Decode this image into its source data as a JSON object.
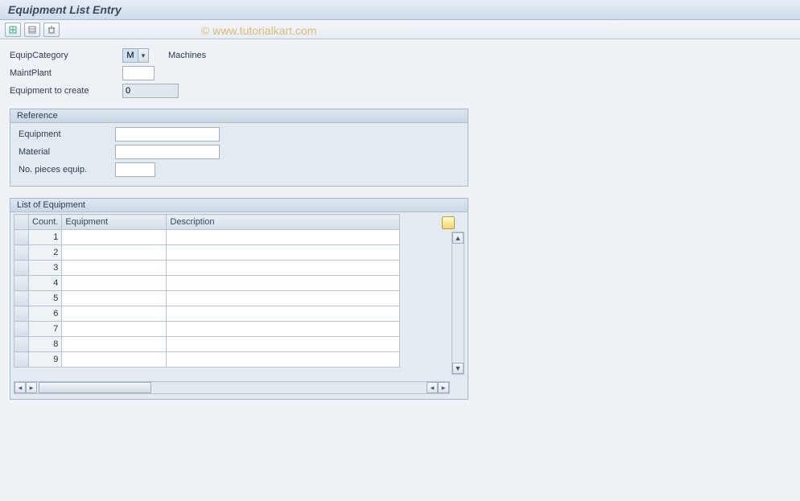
{
  "header": {
    "title": "Equipment List Entry"
  },
  "watermark": "© www.tutorialkart.com",
  "toolbar": {
    "btn_insert": "insert-row",
    "btn_select": "select-rows",
    "btn_delete": "delete-row"
  },
  "form": {
    "equip_category_label": "EquipCategory",
    "equip_category_value": "M",
    "equip_category_text": "Machines",
    "maint_plant_label": "MaintPlant",
    "maint_plant_value": "",
    "equip_to_create_label": "Equipment to create",
    "equip_to_create_value": "0"
  },
  "reference": {
    "title": "Reference",
    "equipment_label": "Equipment",
    "equipment_value": "",
    "material_label": "Material",
    "material_value": "",
    "pieces_label": "No. pieces equip.",
    "pieces_value": ""
  },
  "table": {
    "title": "List of Equipment",
    "columns": {
      "count": "Count.",
      "equipment": "Equipment",
      "description": "Description"
    },
    "rows": [
      {
        "count": "1",
        "equipment": "",
        "description": ""
      },
      {
        "count": "2",
        "equipment": "",
        "description": ""
      },
      {
        "count": "3",
        "equipment": "",
        "description": ""
      },
      {
        "count": "4",
        "equipment": "",
        "description": ""
      },
      {
        "count": "5",
        "equipment": "",
        "description": ""
      },
      {
        "count": "6",
        "equipment": "",
        "description": ""
      },
      {
        "count": "7",
        "equipment": "",
        "description": ""
      },
      {
        "count": "8",
        "equipment": "",
        "description": ""
      },
      {
        "count": "9",
        "equipment": "",
        "description": ""
      }
    ]
  }
}
